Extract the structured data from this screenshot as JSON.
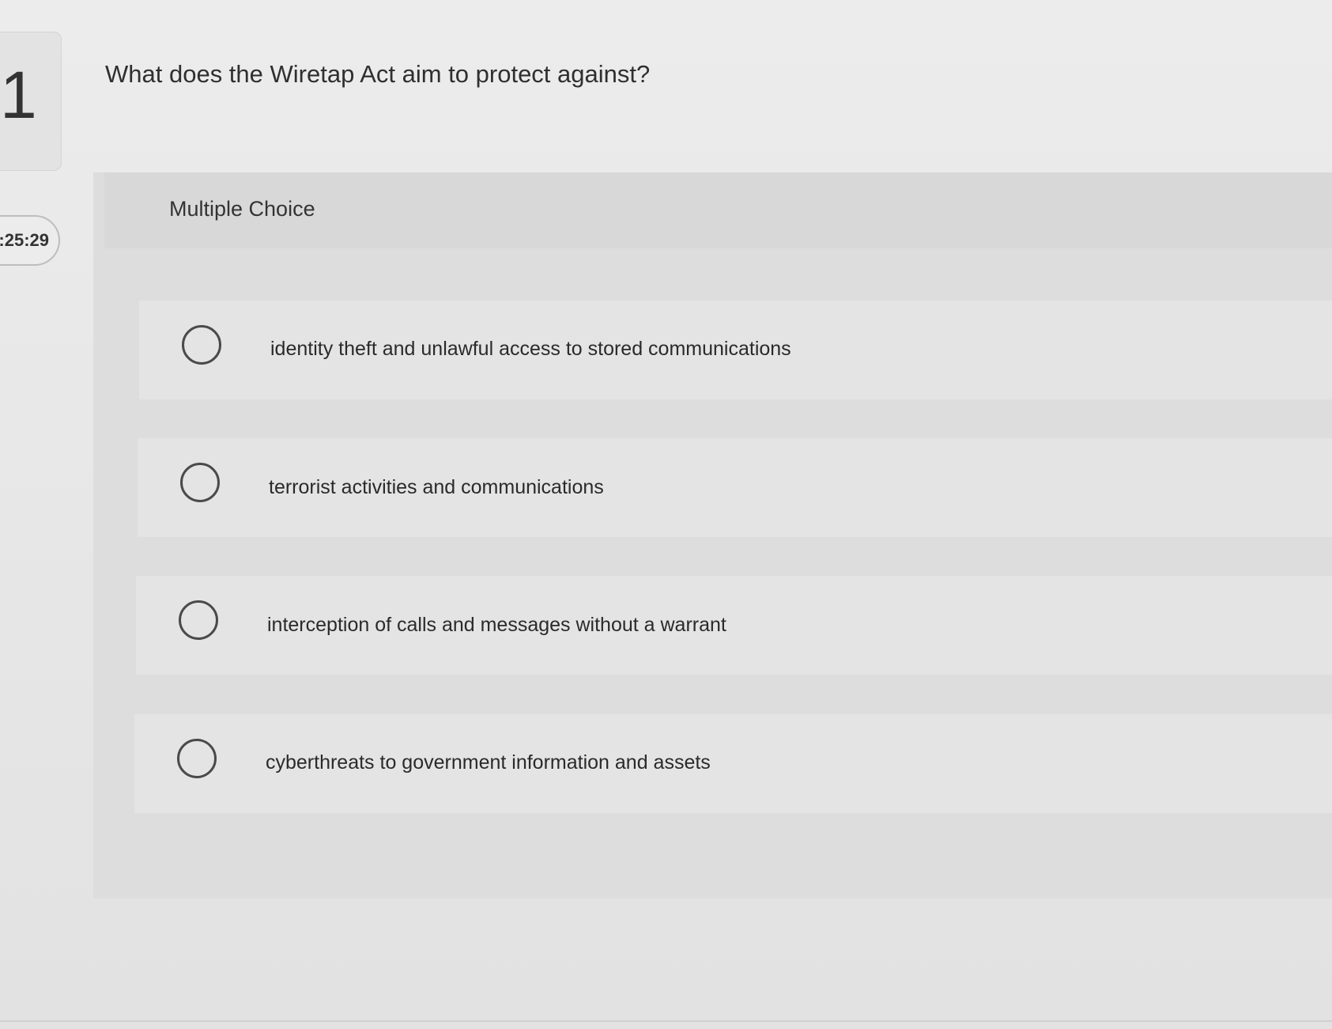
{
  "sidebar": {
    "question_number": "1",
    "timer": ":25:29"
  },
  "question": {
    "text": "What does the Wiretap Act aim to protect against?",
    "type_label": "Multiple Choice"
  },
  "options": [
    {
      "label": "identity theft and unlawful access to stored communications"
    },
    {
      "label": "terrorist activities and communications"
    },
    {
      "label": "interception of calls and messages without a warrant"
    },
    {
      "label": "cyberthreats to government information and assets"
    }
  ]
}
